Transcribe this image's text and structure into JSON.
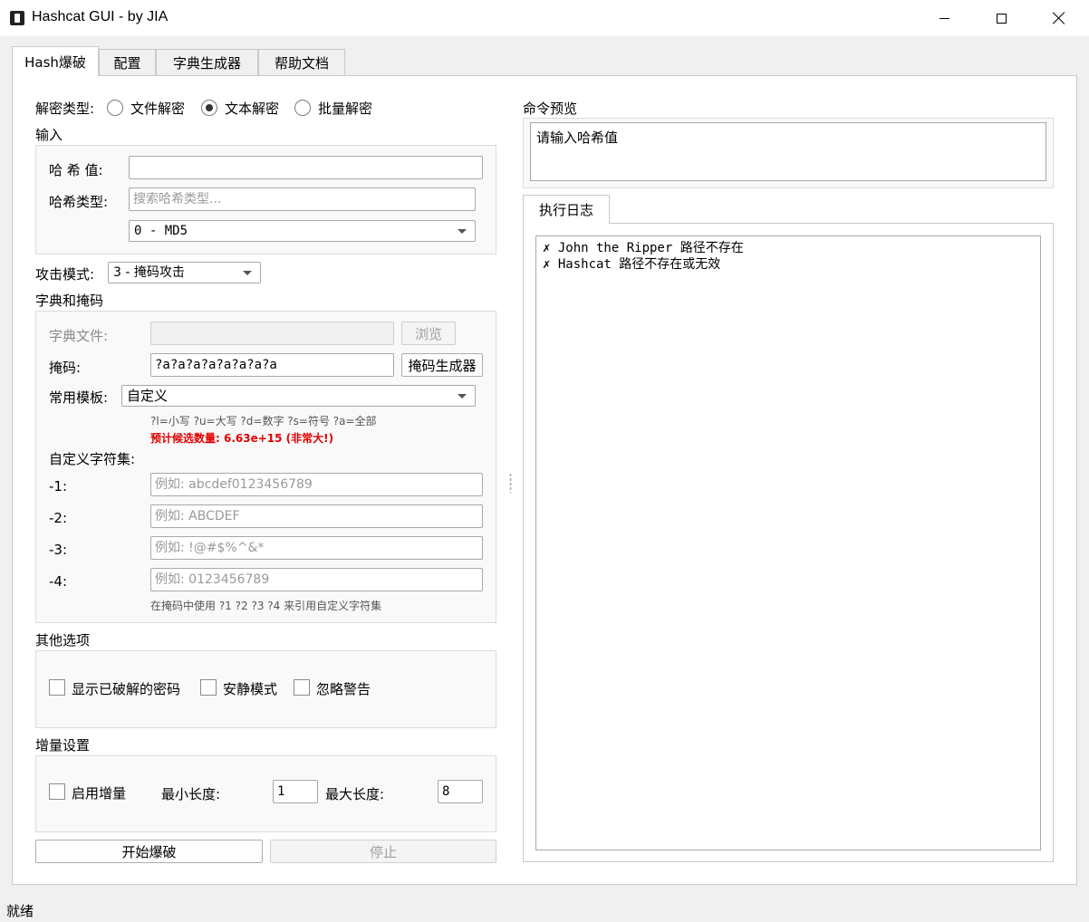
{
  "window": {
    "title": "Hashcat GUI - by JIA",
    "icon": "hashcat-app-icon"
  },
  "tabs": [
    {
      "label": "Hash爆破",
      "active": true
    },
    {
      "label": "配置",
      "active": false
    },
    {
      "label": "字典生成器",
      "active": false
    },
    {
      "label": "帮助文档",
      "active": false
    }
  ],
  "decrypt_type": {
    "label": "解密类型:",
    "options": [
      {
        "label": "文件解密",
        "checked": false
      },
      {
        "label": "文本解密",
        "checked": true
      },
      {
        "label": "批量解密",
        "checked": false
      }
    ]
  },
  "input_group": {
    "title": "输入",
    "hash_label": "哈 希 值:",
    "hash_value": "",
    "hash_type_label": "哈希类型:",
    "hash_type_search_placeholder": "搜索哈希类型...",
    "hash_type_selected": "0 - MD5"
  },
  "attack_mode": {
    "label": "攻击模式:",
    "selected": "3 - 掩码攻击"
  },
  "dict_mask_group": {
    "title": "字典和掩码",
    "dict_file_label": "字典文件:",
    "dict_file_value": "",
    "browse_label": "浏览",
    "mask_label": "掩码:",
    "mask_value": "?a?a?a?a?a?a?a?a",
    "mask_generator_label": "掩码生成器",
    "template_label": "常用模板:",
    "template_selected": "自定义",
    "charset_hint": "?l=小写 ?u=大写 ?d=数字 ?s=符号 ?a=全部",
    "estimate_warning": "预计候选数量: 6.63e+15 (非常大!)",
    "custom_charset_title": "自定义字符集:",
    "custom_charsets": [
      {
        "label": "-1:",
        "placeholder": "例如: abcdef0123456789"
      },
      {
        "label": "-2:",
        "placeholder": "例如: ABCDEF"
      },
      {
        "label": "-3:",
        "placeholder": "例如: !@#$%^&*"
      },
      {
        "label": "-4:",
        "placeholder": "例如: 0123456789"
      }
    ],
    "custom_charset_hint": "在掩码中使用 ?1 ?2 ?3 ?4 来引用自定义字符集"
  },
  "other_options": {
    "title": "其他选项",
    "show_cracked_label": "显示已破解的密码",
    "quiet_label": "安静模式",
    "ignore_warnings_label": "忽略警告"
  },
  "increment": {
    "title": "增量设置",
    "enable_label": "启用增量",
    "min_label": "最小长度:",
    "min_value": "1",
    "max_label": "最大长度:",
    "max_value": "8"
  },
  "actions": {
    "start_label": "开始爆破",
    "stop_label": "停止"
  },
  "command_preview": {
    "title": "命令预览",
    "text": "请输入哈希值"
  },
  "log": {
    "tab_label": "执行日志",
    "lines": [
      "✗ John the Ripper 路径不存在",
      "✗ Hashcat 路径不存在或无效"
    ]
  },
  "status": {
    "text": "就绪"
  }
}
